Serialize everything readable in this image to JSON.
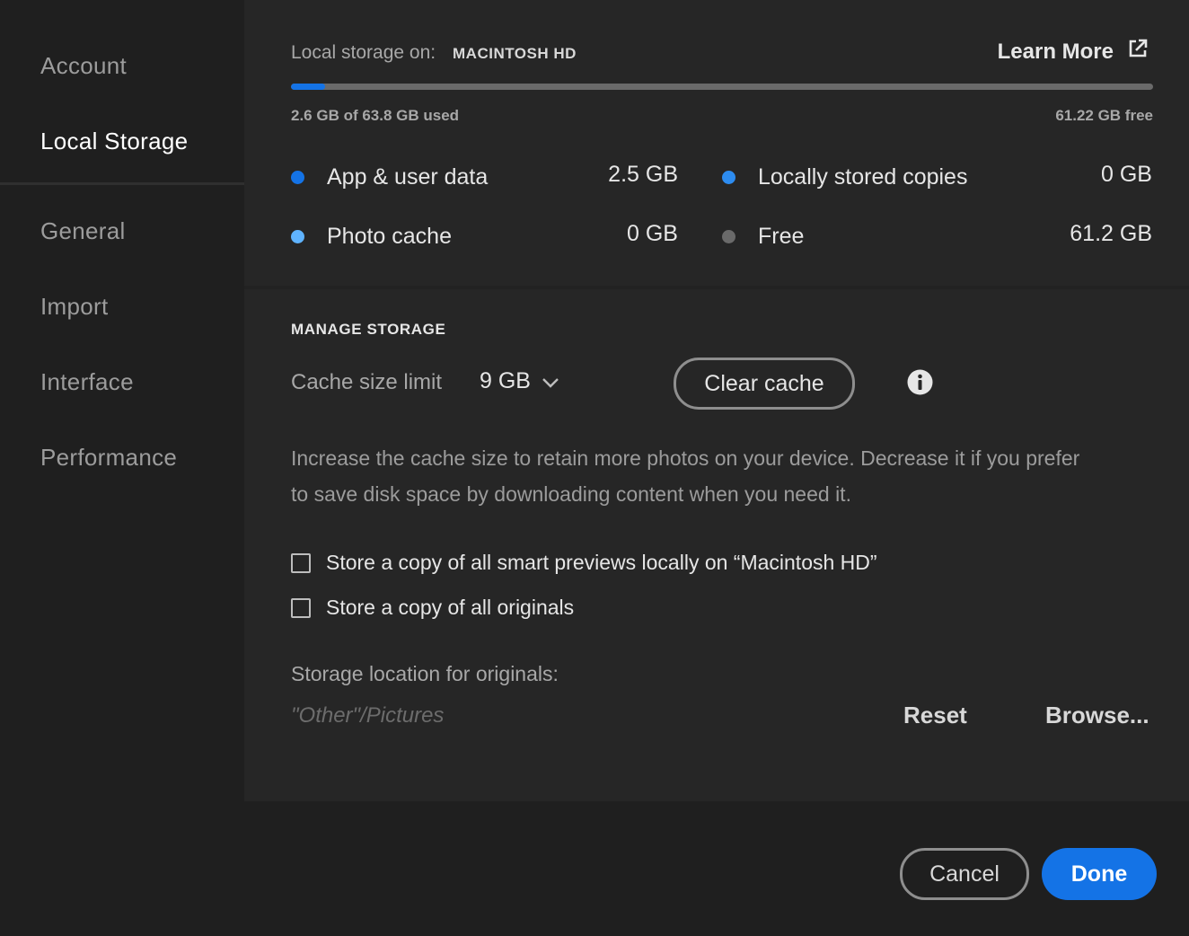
{
  "sidebar": {
    "items": [
      {
        "label": "Account",
        "active": false
      },
      {
        "label": "Local Storage",
        "active": true
      },
      {
        "label": "General",
        "active": false
      },
      {
        "label": "Import",
        "active": false
      },
      {
        "label": "Interface",
        "active": false
      },
      {
        "label": "Performance",
        "active": false
      }
    ]
  },
  "overview": {
    "storage_label": "Local storage on:",
    "drive_name": "MACINTOSH HD",
    "learn_more": "Learn More",
    "used_text": "2.6 GB of 63.8 GB used",
    "free_text": "61.22 GB free",
    "usage_fraction": 0.04,
    "bar_color": "#1473e6",
    "legend": [
      {
        "label": "App & user data",
        "value": "2.5 GB",
        "color": "#1473e6"
      },
      {
        "label": "Locally stored copies",
        "value": "0 GB",
        "color": "#2d8cf0"
      },
      {
        "label": "Photo cache",
        "value": "0 GB",
        "color": "#5fb3ff"
      },
      {
        "label": "Free",
        "value": "61.2 GB",
        "color": "#6a6a6a"
      }
    ]
  },
  "manage": {
    "title": "MANAGE STORAGE",
    "cache_label": "Cache size limit",
    "cache_value": "9 GB",
    "clear_cache": "Clear cache",
    "help_text": "Increase the cache size to retain more photos on your device. Decrease it if you prefer to save disk space by downloading content when you need it.",
    "checkbox_smart_previews": "Store a copy of all smart previews locally on “Macintosh HD”",
    "checkbox_originals": "Store a copy of all originals",
    "location_label": "Storage location for originals:",
    "location_value": "\"Other\"/Pictures",
    "reset": "Reset",
    "browse": "Browse..."
  },
  "footer": {
    "cancel": "Cancel",
    "done": "Done"
  }
}
